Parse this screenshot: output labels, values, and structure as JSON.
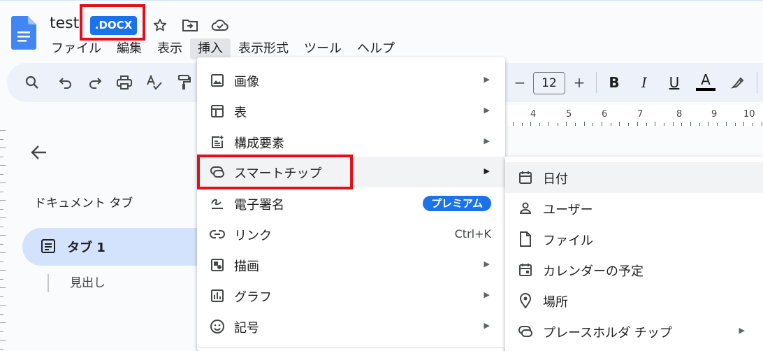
{
  "app": {
    "title": "test",
    "format_badge": ".DOCX",
    "brand_color": "#1a73e8",
    "highlight_color": "#e3101c"
  },
  "menubar": [
    "ファイル",
    "編集",
    "表示",
    "挿入",
    "表示形式",
    "ツール",
    "ヘルプ"
  ],
  "active_menu": "挿入",
  "toolbar": {
    "icons": [
      "search-icon",
      "undo-icon",
      "redo-icon",
      "print-icon",
      "spellcheck-icon",
      "paint-format-icon",
      "decrease-font-icon",
      "increase-font-icon",
      "bold-icon",
      "italic-icon",
      "underline-icon",
      "text-color-icon",
      "highlight-icon"
    ],
    "font_size": "12",
    "minus": "−",
    "plus": "+",
    "bold": "B",
    "italic": "I",
    "underline": "U",
    "text_color": "A"
  },
  "ruler": {
    "numbers": [
      "4",
      "5",
      "6",
      "7",
      "8",
      "9",
      "10"
    ]
  },
  "sidebar": {
    "section_label": "ドキュメント タブ",
    "tab_label": "タブ 1",
    "heading": "見出し"
  },
  "insert_menu": {
    "items": [
      {
        "label": "画像",
        "icon": "image-icon",
        "submenu": true
      },
      {
        "label": "表",
        "icon": "table-icon",
        "submenu": true
      },
      {
        "label": "構成要素",
        "icon": "building-blocks-icon",
        "submenu": true
      },
      {
        "label": "スマートチップ",
        "icon": "smart-chip-icon",
        "submenu": true,
        "highlighted": true
      },
      {
        "label": "電子署名",
        "icon": "esignature-icon",
        "badge": "プレミアム"
      },
      {
        "label": "リンク",
        "icon": "link-icon",
        "shortcut": "Ctrl+K"
      },
      {
        "label": "描画",
        "icon": "drawing-icon",
        "submenu": true
      },
      {
        "label": "グラフ",
        "icon": "chart-icon",
        "submenu": true
      },
      {
        "label": "記号",
        "icon": "emoji-icon",
        "submenu": true
      }
    ]
  },
  "smart_chip_menu": {
    "items": [
      {
        "label": "日付",
        "icon": "calendar-icon",
        "highlighted": true
      },
      {
        "label": "ユーザー",
        "icon": "person-icon"
      },
      {
        "label": "ファイル",
        "icon": "file-icon"
      },
      {
        "label": "カレンダーの予定",
        "icon": "calendar-event-icon"
      },
      {
        "label": "場所",
        "icon": "location-pin-icon"
      },
      {
        "label": "プレースホルダ チップ",
        "icon": "placeholder-chip-icon",
        "submenu": true
      }
    ]
  }
}
